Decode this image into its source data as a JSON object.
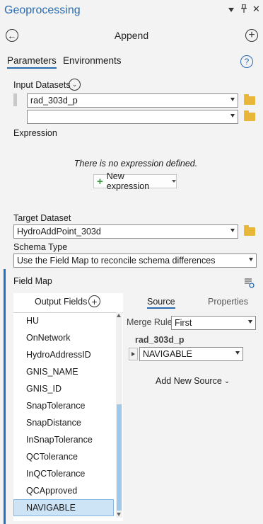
{
  "pane": {
    "title": "Geoprocessing",
    "tb_pin": "ᛁ",
    "tb_close": "✕"
  },
  "tool": {
    "title": "Append"
  },
  "tabs": [
    {
      "label": "Parameters"
    },
    {
      "label": "Environments"
    }
  ],
  "help_glyph": "?",
  "input_datasets": {
    "label": "Input Datasets",
    "values": [
      "rad_303d_p",
      ""
    ]
  },
  "expression": {
    "label": "Expression",
    "empty_text": "There is no expression defined.",
    "new_button": "New expression"
  },
  "target_dataset": {
    "label": "Target Dataset",
    "value": "HydroAddPoint_303d"
  },
  "schema_type": {
    "label": "Schema Type",
    "value": "Use the Field Map to reconcile schema differences"
  },
  "field_map": {
    "label": "Field Map",
    "output_fields_label": "Output Fields",
    "fields": [
      "HU",
      "OnNetwork",
      "HydroAddressID",
      "GNIS_NAME",
      "GNIS_ID",
      "SnapTolerance",
      "SnapDistance",
      "InSnapTolerance",
      "QCTolerance",
      "InQCTolerance",
      "QCApproved",
      "NAVIGABLE"
    ],
    "selected_field": "NAVIGABLE",
    "tabs": {
      "source": "Source",
      "properties": "Properties"
    },
    "merge_rule_label": "Merge Rule",
    "merge_rule_value": "First",
    "source_dataset": "rad_303d_p",
    "source_field": "NAVIGABLE",
    "add_source": "Add New Source"
  },
  "colors": {
    "accent": "#2a6bb0",
    "selected": "#cde3f6",
    "folder": "#e8b73a",
    "plus_green": "#3a9a3a"
  }
}
